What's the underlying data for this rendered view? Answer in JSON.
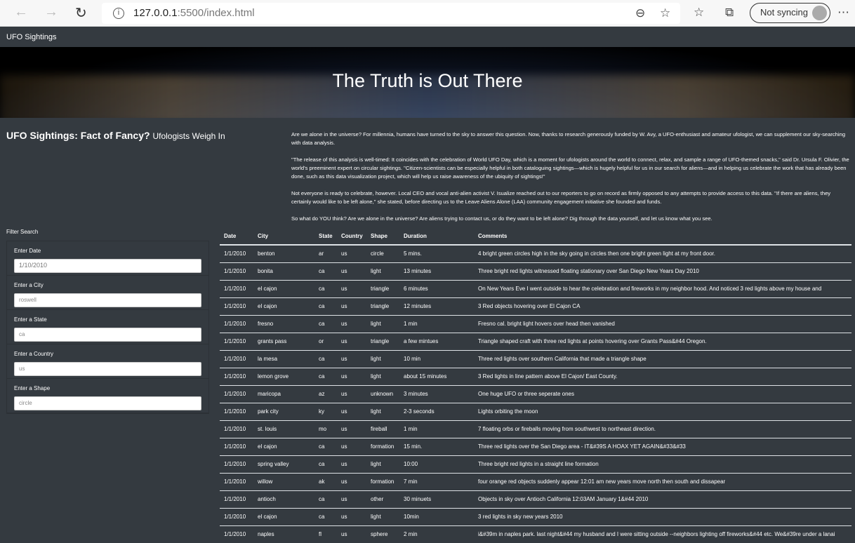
{
  "browser": {
    "url_host": "127.0.0.1",
    "url_path": ":5500/index.html",
    "sync_label": "Not syncing"
  },
  "navbar": {
    "brand": "UFO Sightings"
  },
  "banner": {
    "title": "The Truth is Out There"
  },
  "article": {
    "title": "UFO Sightings: Fact of Fancy?",
    "subtitle": "Ufologists Weigh In",
    "paragraphs": [
      "Are we alone in the universe? For millennia, humans have turned to the sky to answer this question. Now, thanks to research generously funded by W. Avy, a UFO-enthusiast and amateur ufologist, we can supplement our sky-searching with data analysis.",
      "\"The release of this analysis is well-timed: It coincides with the celebration of World UFO Day, which is a moment for ufologists around the world to connect, relax, and sample a range of UFO-themed snacks,\" said Dr. Ursula F. Olivier, the world's preeminent expert on circular sightings. \"Citizen-scientists can be especially helpful in both cataloguing sightings—which is hugely helpful for us in our search for aliens—and in helping us celebrate the work that has already been done, such as this data visualization project, which will help us raise awareness of the ubiquity of sightings!\"",
      "Not everyone is ready to celebrate, however. Local CEO and vocal anti-alien activist V. Isualize reached out to our reporters to go on record as firmly opposed to any attempts to provide access to this data. \"If there are aliens, they certainly would like to be left alone,\" she stated, before directing us to the Leave Aliens Alone (LAA) community engagement initiative she founded and funds.",
      "So what do YOU think? Are we alone in the universe? Are aliens trying to contact us, or do they want to be left alone? Dig through the data yourself, and let us know what you see."
    ]
  },
  "filters": {
    "heading": "Filter Search",
    "items": [
      {
        "label": "Enter Date",
        "placeholder": "1/10/2010"
      },
      {
        "label": "Enter a City",
        "placeholder": "roswell"
      },
      {
        "label": "Enter a State",
        "placeholder": "ca"
      },
      {
        "label": "Enter a Country",
        "placeholder": "us"
      },
      {
        "label": "Enter a Shape",
        "placeholder": "circle"
      }
    ]
  },
  "table": {
    "headers": [
      "Date",
      "City",
      "State",
      "Country",
      "Shape",
      "Duration",
      "Comments"
    ],
    "rows": [
      [
        "1/1/2010",
        "benton",
        "ar",
        "us",
        "circle",
        "5 mins.",
        "4 bright green circles high in the sky going in circles then one bright green light at my front door."
      ],
      [
        "1/1/2010",
        "bonita",
        "ca",
        "us",
        "light",
        "13 minutes",
        "Three bright red lights witnessed floating stationary over San Diego New Years Day 2010"
      ],
      [
        "1/1/2010",
        "el cajon",
        "ca",
        "us",
        "triangle",
        "6 minutes",
        "On New Years Eve I went outside to hear the celebration and fireworks in my neighbor hood. And noticed 3 red lights above my house and"
      ],
      [
        "1/1/2010",
        "el cajon",
        "ca",
        "us",
        "triangle",
        "12 minutes",
        "3 Red objects hovering over El Cajon CA"
      ],
      [
        "1/1/2010",
        "fresno",
        "ca",
        "us",
        "light",
        "1 min",
        "Fresno cal. bright light hovers over head then vanished"
      ],
      [
        "1/1/2010",
        "grants pass",
        "or",
        "us",
        "triangle",
        "a few mintues",
        "Triangle shaped craft with three red lights at points hovering over Grants Pass&#44 Oregon."
      ],
      [
        "1/1/2010",
        "la mesa",
        "ca",
        "us",
        "light",
        "10 min",
        "Three red lights over southern California that made a triangle shape"
      ],
      [
        "1/1/2010",
        "lemon grove",
        "ca",
        "us",
        "light",
        "about 15 minutes",
        "3 Red lights in line pattern above El Cajon/ East County."
      ],
      [
        "1/1/2010",
        "maricopa",
        "az",
        "us",
        "unknown",
        "3 minutes",
        "One huge UFO or three seperate ones"
      ],
      [
        "1/1/2010",
        "park city",
        "ky",
        "us",
        "light",
        "2-3 seconds",
        "Lights orbiting the moon"
      ],
      [
        "1/1/2010",
        "st. louis",
        "mo",
        "us",
        "fireball",
        "1 min",
        "7 floating orbs or fireballs moving from southwest to northeast direction."
      ],
      [
        "1/1/2010",
        "el cajon",
        "ca",
        "us",
        "formation",
        "15 min.",
        "Three red lights over the San Diego area - IT&#39S A HOAX YET AGAIN&#33&#33"
      ],
      [
        "1/1/2010",
        "spring valley",
        "ca",
        "us",
        "light",
        "10:00",
        "Three bright red lights in a straight line formation"
      ],
      [
        "1/1/2010",
        "willow",
        "ak",
        "us",
        "formation",
        "7 min",
        "four orange red objects suddenly appear 12:01 am new years move north then south and dissapear"
      ],
      [
        "1/1/2010",
        "antioch",
        "ca",
        "us",
        "other",
        "30 minuets",
        "Objects in sky over Antioch California 12:03AM January 1&#44 2010"
      ],
      [
        "1/1/2010",
        "el cajon",
        "ca",
        "us",
        "light",
        "10min",
        "3 red lights in sky new years 2010"
      ],
      [
        "1/1/2010",
        "naples",
        "fl",
        "us",
        "sphere",
        "2 min",
        "i&#39m in naples park. last night&#44 my husband and I were sitting outside --neighbors lighting off fireworks&#44 etc. We&#39re under a lanai"
      ]
    ]
  }
}
